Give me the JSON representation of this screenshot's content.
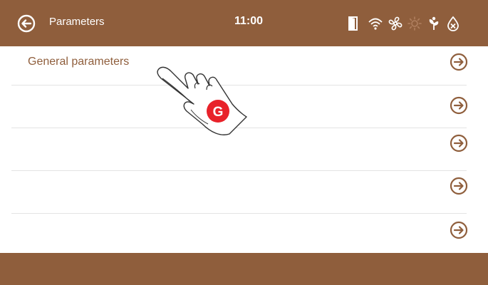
{
  "header": {
    "title": "Parameters",
    "time": "11:00"
  },
  "status_icons": [
    "door-icon",
    "wifi-icon",
    "fan-icon",
    "sun-icon",
    "plant-icon",
    "water-drop-icon"
  ],
  "list": {
    "items": [
      {
        "label": "General parameters"
      },
      {
        "label": ""
      },
      {
        "label": ""
      },
      {
        "label": ""
      },
      {
        "label": ""
      }
    ]
  },
  "tap_hint": {
    "badge": "G"
  },
  "colors": {
    "brand": "#8f5e3c",
    "badge": "#e8222a",
    "divider": "#e3e3e3"
  }
}
